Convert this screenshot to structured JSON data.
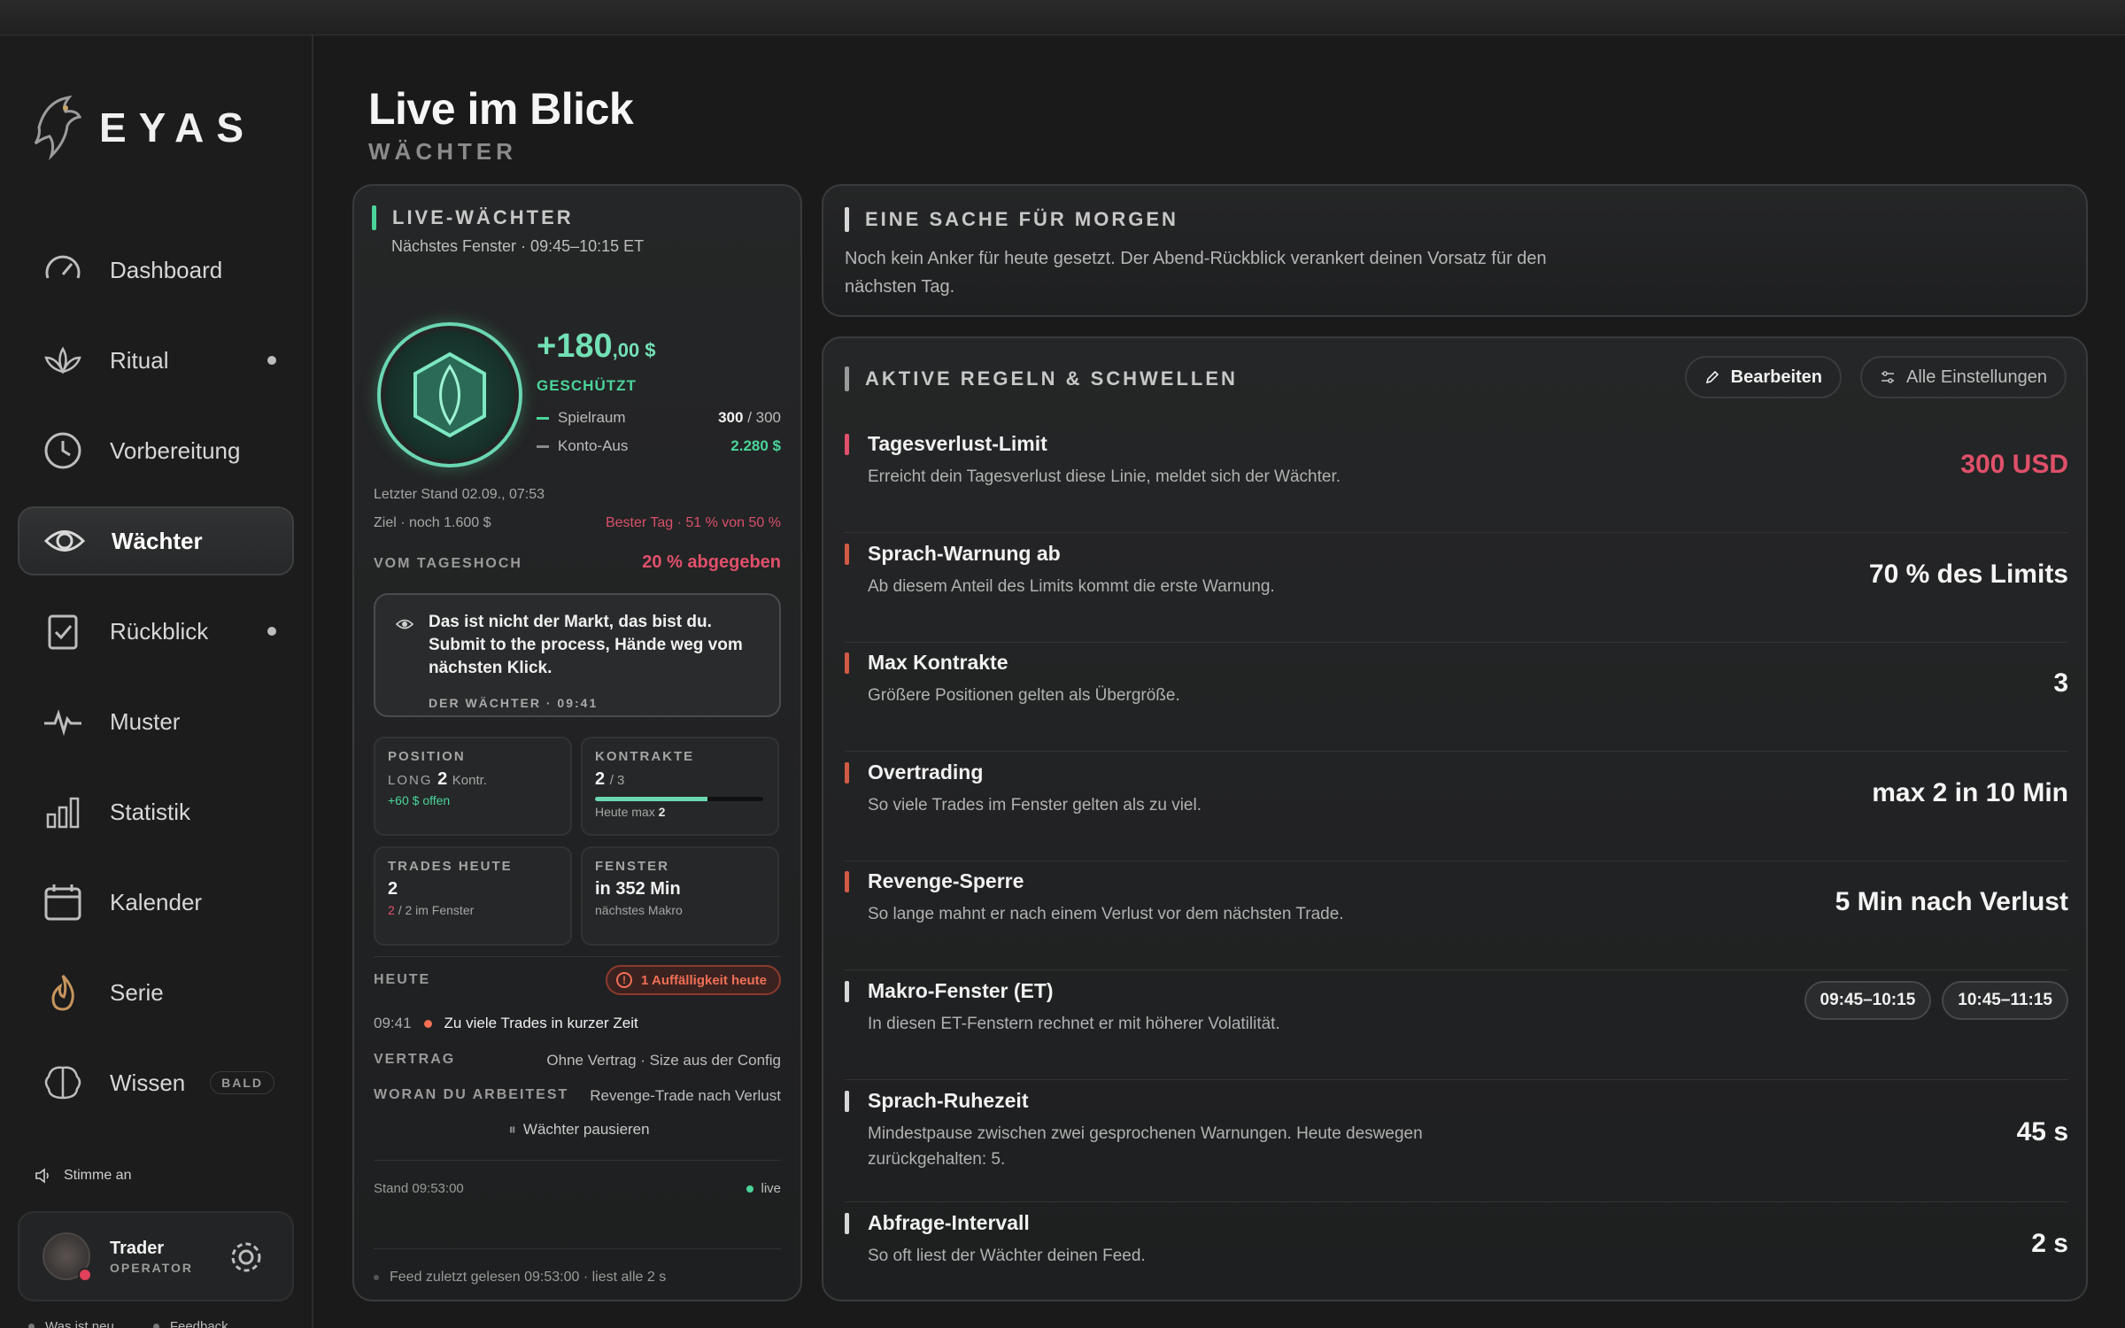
{
  "app": {
    "name": "EYAS"
  },
  "sidebar": {
    "items": [
      {
        "label": "Dashboard",
        "icon": "gauge-icon",
        "dot": false
      },
      {
        "label": "Ritual",
        "icon": "lotus-icon",
        "dot": true
      },
      {
        "label": "Vorbereitung",
        "icon": "clock-icon",
        "dot": false
      },
      {
        "label": "Wächter",
        "icon": "eye-icon",
        "dot": false,
        "active": true
      },
      {
        "label": "Rückblick",
        "icon": "clipboard-check-icon",
        "dot": true
      },
      {
        "label": "Muster",
        "icon": "pulse-icon",
        "dot": false
      },
      {
        "label": "Statistik",
        "icon": "bar-chart-icon",
        "dot": false
      },
      {
        "label": "Kalender",
        "icon": "calendar-icon",
        "dot": false
      },
      {
        "label": "Serie",
        "icon": "flame-icon",
        "dot": false
      },
      {
        "label": "Wissen",
        "icon": "brain-icon",
        "badge": "BALD"
      }
    ],
    "voice_label": "Stimme an",
    "user": {
      "name": "Trader",
      "role": "OPERATOR"
    },
    "footer": {
      "whats_new": "Was ist neu",
      "feedback": "Feedback"
    }
  },
  "page": {
    "title": "Live im Blick",
    "subtitle": "WÄCHTER"
  },
  "live": {
    "title": "LIVE-WÄCHTER",
    "next_window": "Nächstes Fenster · 09:45–10:15 ET",
    "pnl_main": "+180",
    "pnl_cents": ",00 $",
    "status": "GESCHÜTZT",
    "spielraum_label": "Spielraum",
    "spielraum_value": "300",
    "spielraum_max": "/ 300",
    "konto_label": "Konto-Aus",
    "konto_value": "2.280 $",
    "last_update": "Letzter Stand 02.09., 07:53",
    "goal": "Ziel · noch 1.600 $",
    "best_day": "Bester Tag · 51 % von 50 %",
    "from_high_label": "VOM TAGESHOCH",
    "from_high_value": "20 % abgegeben",
    "quote": "Das ist nicht der Markt, das bist du. Submit to the process, Hände weg vom nächsten Klick.",
    "quote_by": "DER WÄCHTER · 09:41",
    "position": {
      "cap": "POSITION",
      "side": "LONG",
      "qty": "2",
      "unit": "Kontr.",
      "open": "+60 $ offen"
    },
    "contracts": {
      "cap": "KONTRAKTE",
      "value": "2",
      "max": "/ 3",
      "progress": 0.667,
      "note": "Heute max",
      "note_value": "2"
    },
    "trades": {
      "cap": "TRADES HEUTE",
      "value": "2",
      "sub_a": "2",
      "sub_b": "/ 2 im Fenster"
    },
    "window": {
      "cap": "FENSTER",
      "value": "in 352 Min",
      "sub": "nächstes Makro"
    },
    "today_label": "HEUTE",
    "anomaly": "1 Auffälligkeit heute",
    "event_time": "09:41",
    "event_text": "Zu viele Trades in kurzer Zeit",
    "contract_label": "VERTRAG",
    "contract_value": "Ohne Vertrag · Size aus der Config",
    "working_label": "WORAN DU ARBEITEST",
    "working_value": "Revenge-Trade nach Verlust",
    "pause": "Wächter pausieren",
    "stand": "Stand 09:53:00",
    "live_label": "live",
    "feed": "Feed zuletzt gelesen 09:53:00 · liest alle 2 s"
  },
  "morgen": {
    "title": "EINE SACHE FÜR MORGEN",
    "text": "Noch kein Anker für heute gesetzt. Der Abend-Rückblick verankert deinen Vorsatz für den nächsten Tag."
  },
  "rules": {
    "title": "AKTIVE REGELN & SCHWELLEN",
    "edit": "Bearbeiten",
    "all_settings": "Alle Einstellungen",
    "items": [
      {
        "title": "Tagesverlust-Limit",
        "desc": "Erreicht dein Tagesverlust diese Linie, meldet sich der Wächter.",
        "value": "300 USD",
        "color": "#e0506a"
      },
      {
        "title": "Sprach-Warnung ab",
        "desc": "Ab diesem Anteil des Limits kommt die erste Warnung.",
        "value": "70 % des Limits",
        "color": "#d15a45"
      },
      {
        "title": "Max Kontrakte",
        "desc": "Größere Positionen gelten als Übergröße.",
        "value": "3",
        "color": "#d15a45"
      },
      {
        "title": "Overtrading",
        "desc": "So viele Trades im Fenster gelten als zu viel.",
        "value": "max 2 in 10 Min",
        "color": "#d15a45"
      },
      {
        "title": "Revenge-Sperre",
        "desc": "So lange mahnt er nach einem Verlust vor dem nächsten Trade.",
        "value": "5 Min nach Verlust",
        "color": "#d15a45"
      },
      {
        "title": "Makro-Fenster (ET)",
        "desc": "In diesen ET-Fenstern rechnet er mit höherer Volatilität.",
        "chips": [
          "09:45–10:15",
          "10:45–11:15"
        ],
        "color": "#d7d7d7"
      },
      {
        "title": "Sprach-Ruhezeit",
        "desc": "Mindestpause zwischen zwei gesprochenen Warnungen. Heute deswegen zurückgehalten: 5.",
        "value": "45 s",
        "color": "#d7d7d7"
      },
      {
        "title": "Abfrage-Intervall",
        "desc": "So oft liest der Wächter deinen Feed.",
        "value": "2 s",
        "color": "#d7d7d7"
      }
    ]
  }
}
